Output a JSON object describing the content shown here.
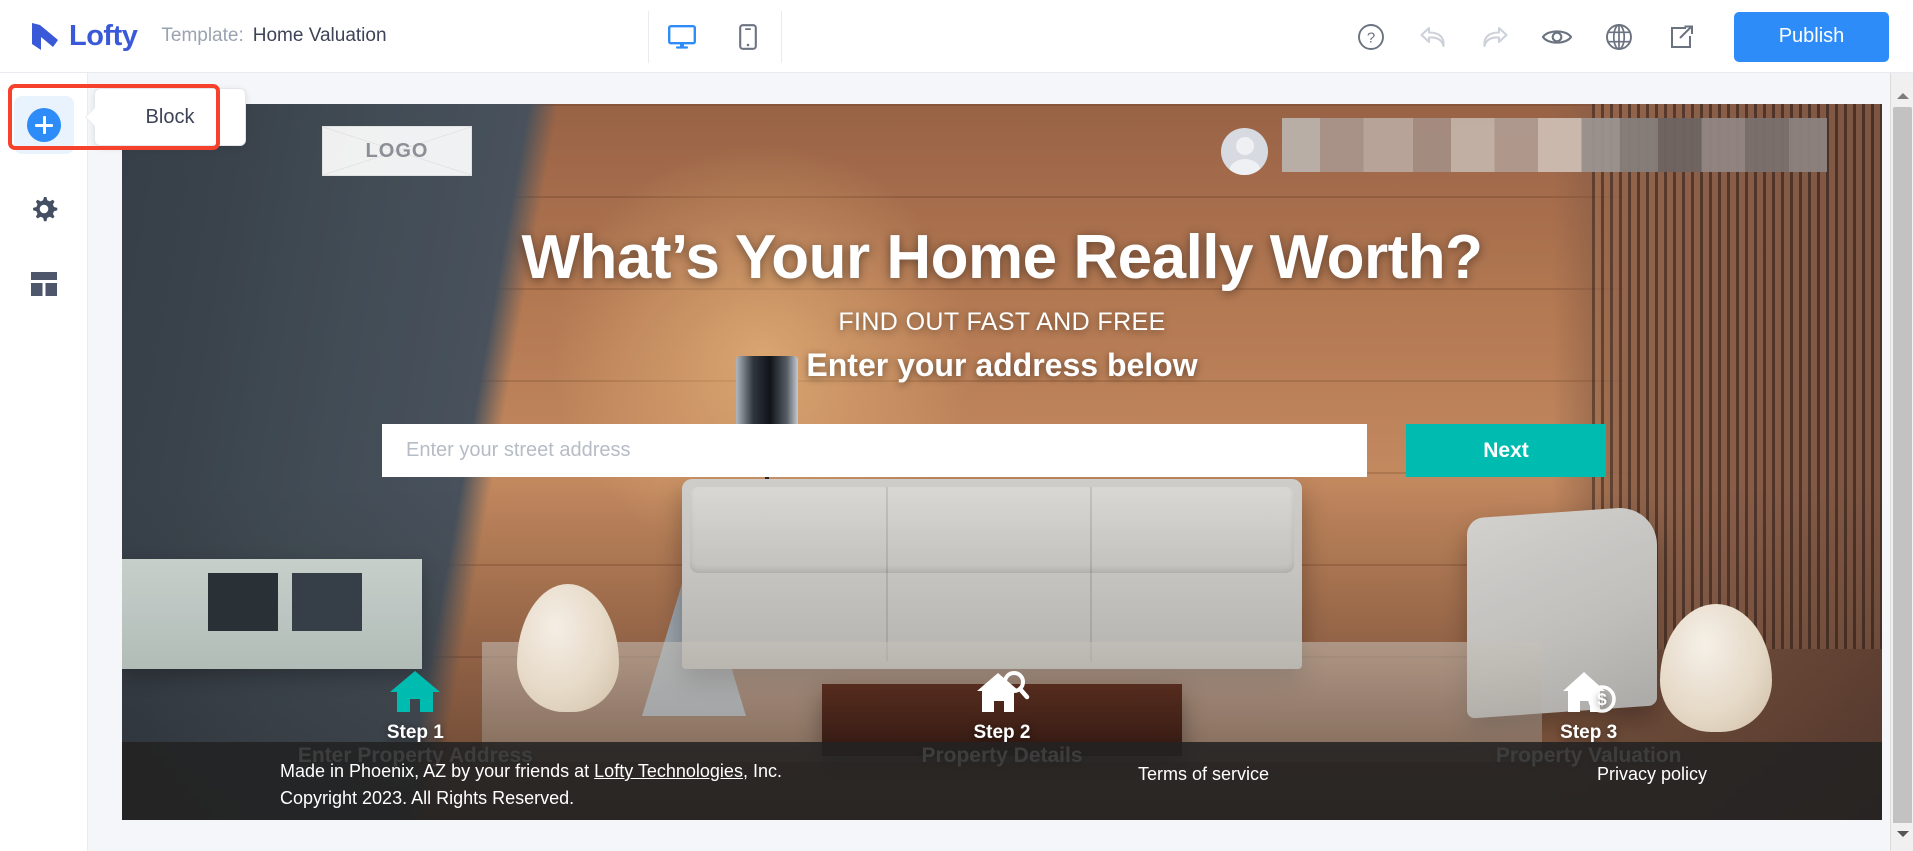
{
  "app": {
    "brand_name": "Lofty",
    "template_label": "Template:",
    "template_name": "Home Valuation",
    "publish_label": "Publish",
    "accent_blue": "#2d8cf8",
    "brand_blue": "#3959d9",
    "accent_teal": "#00bcb0",
    "highlight_red": "#f6412d"
  },
  "devices": [
    {
      "name": "desktop-view-button",
      "icon": "monitor-icon",
      "active": true
    },
    {
      "name": "mobile-view-button",
      "icon": "mobile-icon",
      "active": false
    }
  ],
  "tools": [
    {
      "name": "help-button",
      "icon": "question-circle-icon",
      "disabled": false
    },
    {
      "name": "undo-button",
      "icon": "undo-arrow-icon",
      "disabled": true
    },
    {
      "name": "redo-button",
      "icon": "redo-arrow-icon",
      "disabled": true
    },
    {
      "name": "preview-button",
      "icon": "eye-icon",
      "disabled": false
    },
    {
      "name": "language-button",
      "icon": "globe-icon",
      "disabled": false
    },
    {
      "name": "share-button",
      "icon": "share-box-icon",
      "disabled": false
    }
  ],
  "sidebar": {
    "items": [
      {
        "name": "add-block",
        "icon": "plus-circle-icon",
        "active": true
      },
      {
        "name": "settings",
        "icon": "gear-icon",
        "active": false
      },
      {
        "name": "layout",
        "icon": "layout-grid-icon",
        "active": false
      }
    ]
  },
  "tooltip": {
    "label": "Block"
  },
  "page": {
    "logo_placeholder": "LOGO",
    "headline": "What’s Your Home Really Worth?",
    "subheading": "FIND OUT FAST AND FREE",
    "sub_subheading": "Enter your address below",
    "address_placeholder": "Enter your street address",
    "address_value": "",
    "next_label": "Next",
    "steps": [
      {
        "num": "Step 1",
        "label": "Enter Property Address",
        "icon": "home-icon",
        "color": "#00bcb0"
      },
      {
        "num": "Step 2",
        "label": "Property Details",
        "icon": "home-search-icon",
        "color": "#ffffff"
      },
      {
        "num": "Step 3",
        "label": "Property Valuation",
        "icon": "home-dollar-icon",
        "color": "#ffffff"
      }
    ],
    "footer": {
      "made_in_prefix": "Made in Phoenix, AZ by your friends at ",
      "company_link": "Lofty Technologies",
      "made_in_suffix": ", Inc.",
      "copyright": "Copyright 2023. All Rights Reserved.",
      "terms": "Terms of service",
      "privacy": "Privacy policy"
    }
  }
}
